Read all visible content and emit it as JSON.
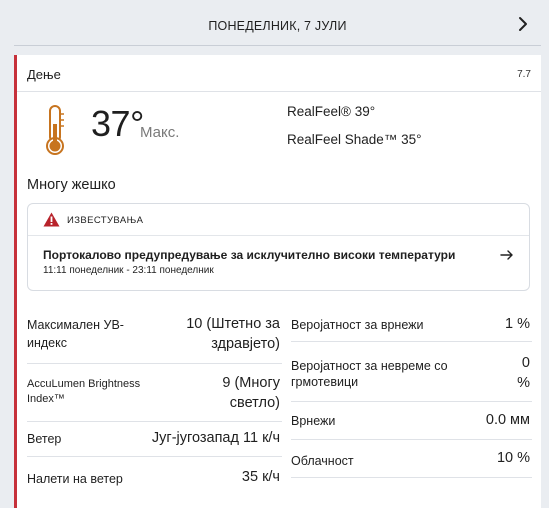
{
  "header": {
    "title": "ПОНЕДЕЛНИК, 7 ЈУЛИ",
    "next_icon": "chevron-right-icon"
  },
  "period": {
    "label": "Дење",
    "time": "7.7"
  },
  "current": {
    "icon": "thermometer-icon",
    "temp": "37°",
    "temp_label": "Макс.",
    "realfeel": "RealFeel® 39°",
    "realfeel_shade": "RealFeel Shade™ 35°",
    "phrase": "Многу жешко"
  },
  "alert": {
    "icon": "warning-icon",
    "title": "ИЗВЕСТУВАЊА",
    "message": "Портокалово предупредување за исклучително високи температури",
    "range": "11:11 понеделник - 23:11 понеделник",
    "arrow_icon": "arrow-right-icon"
  },
  "details_left": [
    {
      "label": "Максимален УВ-индекс",
      "value": "10 (Штетно за здравјето)"
    },
    {
      "label": "AccuLumen Brightness Index™",
      "value": "9 (Многу светло)"
    },
    {
      "label": "Ветер",
      "value": "Југ-југозапад 11 к/ч"
    },
    {
      "label": "Налети на ветер",
      "value": "35 к/ч"
    }
  ],
  "details_right": [
    {
      "label": "Веројатност за врнежи",
      "value": "1 %"
    },
    {
      "label": "Веројатност за невреме со грмотевици",
      "value": "0 %"
    },
    {
      "label": "Врнежи",
      "value": "0.0 мм"
    },
    {
      "label": "Облачност",
      "value": "10 %"
    }
  ],
  "colors": {
    "accent": "#c6303a",
    "warning": "#b8232b",
    "thermometer": "#c7741f",
    "background": "#eaedf1"
  }
}
